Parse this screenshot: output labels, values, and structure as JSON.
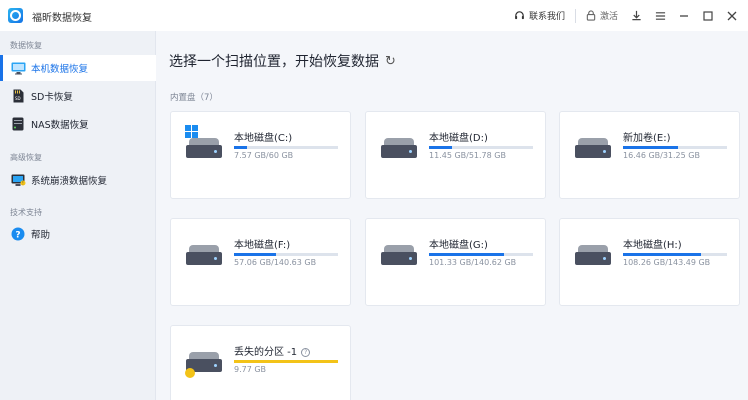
{
  "app": {
    "title": "福昕数据恢复"
  },
  "titlebar": {
    "contact_label": "联系我们",
    "activate_label": "激活"
  },
  "sidebar": {
    "sections": [
      {
        "label": "数据恢复",
        "items": [
          {
            "label": "本机数据恢复",
            "icon": "monitor-icon",
            "active": true
          },
          {
            "label": "SD卡恢复",
            "icon": "sd-card-icon"
          },
          {
            "label": "NAS数据恢复",
            "icon": "nas-icon"
          }
        ]
      },
      {
        "label": "高级恢复",
        "items": [
          {
            "label": "系统崩溃数据恢复",
            "icon": "system-crash-icon"
          }
        ]
      },
      {
        "label": "技术支持",
        "items": [
          {
            "label": "帮助",
            "icon": "help-icon"
          }
        ]
      }
    ]
  },
  "main": {
    "heading": "选择一个扫描位置，开始恢复数据",
    "group_label": "内置盘（7）",
    "drives": [
      {
        "name": "本地磁盘(C:)",
        "size": "7.57 GB/60 GB",
        "used": 0.126,
        "system": true
      },
      {
        "name": "本地磁盘(D:)",
        "size": "11.45 GB/51.78 GB",
        "used": 0.221
      },
      {
        "name": "新加卷(E:)",
        "size": "16.46 GB/31.25 GB",
        "used": 0.527
      },
      {
        "name": "本地磁盘(F:)",
        "size": "57.06 GB/140.63 GB",
        "used": 0.406
      },
      {
        "name": "本地磁盘(G:)",
        "size": "101.33 GB/140.62 GB",
        "used": 0.721
      },
      {
        "name": "本地磁盘(H:)",
        "size": "108.26 GB/143.49 GB",
        "used": 0.754
      },
      {
        "name": "丢失的分区 -1",
        "size": "9.77 GB",
        "used": 1.0,
        "lost": true
      }
    ]
  },
  "colors": {
    "accent": "#1a73e8",
    "lost": "#f3c318"
  }
}
